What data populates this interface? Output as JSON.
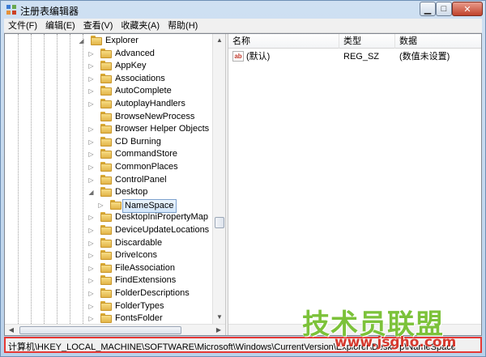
{
  "window": {
    "title": "注册表编辑器",
    "controls": {
      "minimize": "▁",
      "maximize": "□",
      "close": "✕"
    }
  },
  "menu": [
    "文件(F)",
    "编辑(E)",
    "查看(V)",
    "收藏夹(A)",
    "帮助(H)"
  ],
  "tree": {
    "items": [
      {
        "label": "Explorer",
        "state": "expanded"
      },
      {
        "label": "Advanced",
        "state": "collapsed"
      },
      {
        "label": "AppKey",
        "state": "collapsed"
      },
      {
        "label": "Associations",
        "state": "collapsed"
      },
      {
        "label": "AutoComplete",
        "state": "collapsed"
      },
      {
        "label": "AutoplayHandlers",
        "state": "collapsed"
      },
      {
        "label": "BrowseNewProcess",
        "state": "leaf"
      },
      {
        "label": "Browser Helper Objects",
        "state": "collapsed"
      },
      {
        "label": "CD Burning",
        "state": "collapsed"
      },
      {
        "label": "CommandStore",
        "state": "collapsed"
      },
      {
        "label": "CommonPlaces",
        "state": "collapsed"
      },
      {
        "label": "ControlPanel",
        "state": "collapsed"
      },
      {
        "label": "Desktop",
        "state": "expanded"
      },
      {
        "label": "NameSpace",
        "state": "collapsed",
        "selected": true
      },
      {
        "label": "DesktopIniPropertyMap",
        "state": "collapsed"
      },
      {
        "label": "DeviceUpdateLocations",
        "state": "collapsed"
      },
      {
        "label": "Discardable",
        "state": "collapsed"
      },
      {
        "label": "DriveIcons",
        "state": "collapsed"
      },
      {
        "label": "FileAssociation",
        "state": "collapsed"
      },
      {
        "label": "FindExtensions",
        "state": "collapsed"
      },
      {
        "label": "FolderDescriptions",
        "state": "collapsed"
      },
      {
        "label": "FolderTypes",
        "state": "collapsed"
      },
      {
        "label": "FontsFolder",
        "state": "collapsed"
      }
    ],
    "expanded_glyph": "◢",
    "collapsed_glyph": "▷"
  },
  "list": {
    "columns": [
      "名称",
      "类型",
      "数据"
    ],
    "rows": [
      {
        "icon": "ab",
        "name": "(默认)",
        "type": "REG_SZ",
        "data": "(数值未设置)"
      }
    ]
  },
  "statusbar": {
    "path": "计算机\\HKEY_LOCAL_MACHINE\\SOFTWARE\\Microsoft\\Windows\\CurrentVersion\\Explorer\\Desktop\\NameSpace"
  },
  "watermark": {
    "title": "技术员联盟",
    "url": "www.jsgho.com"
  },
  "colors": {
    "statusbar_highlight": "#e53935",
    "folder": "#f2c94c",
    "watermark_green": "#7cc23a",
    "watermark_red": "#d63a2f"
  }
}
